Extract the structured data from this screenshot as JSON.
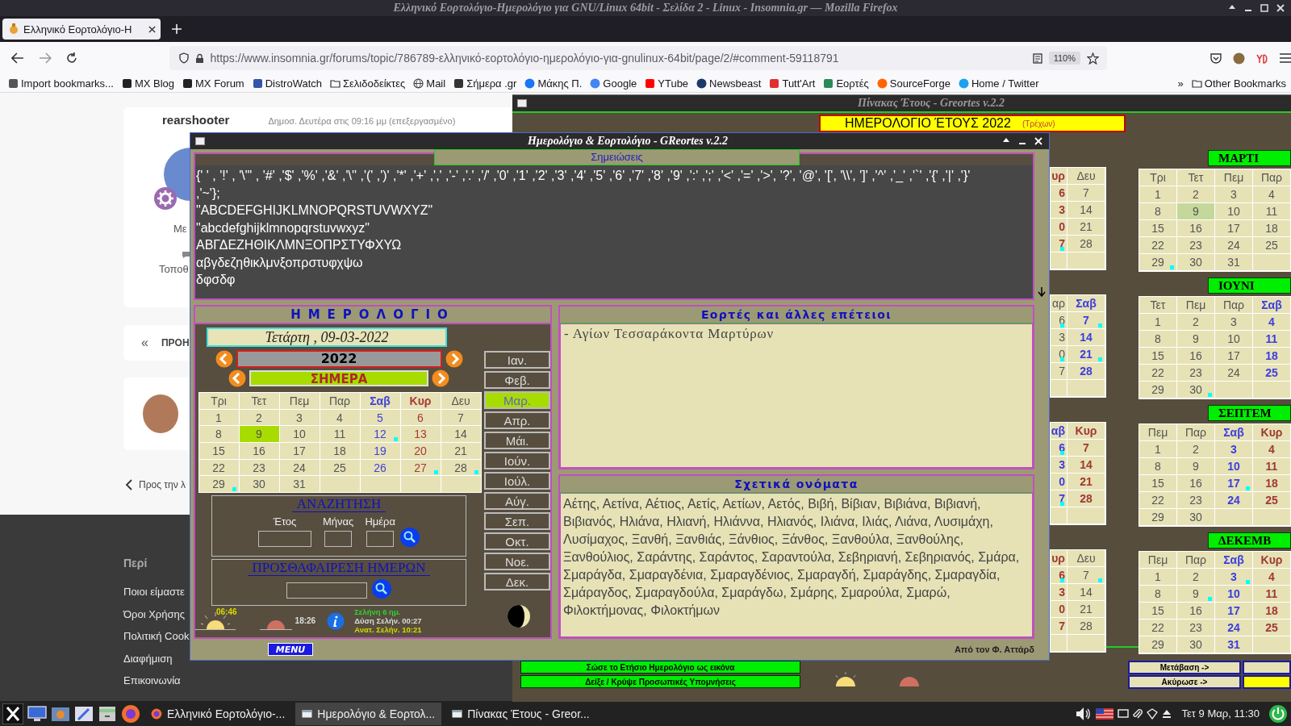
{
  "browser": {
    "title": "Ελληνικό Εορτολόγιο-Ημερολόγιο για GNU/Linux 64bit - Σελίδα 2 - Linux - Insomnia.gr — Mozilla Firefox",
    "tabs": [
      {
        "label": "Ελληνικό Εορτολόγιο-Η",
        "selected": true
      }
    ],
    "url": "https://www.insomnia.gr/forums/topic/786789-ελληνικό-εορτολόγιο-ημερολόγιο-για-gnulinux-64bit/page/2/#comment-59118791",
    "zoom": "110%",
    "bookmarks": [
      {
        "label": "Import bookmarks...",
        "kind": "import"
      },
      {
        "label": "MX Blog",
        "kind": "mx"
      },
      {
        "label": "MX Forum",
        "kind": "mx"
      },
      {
        "label": "DistroWatch",
        "kind": "distro"
      },
      {
        "label": "Σελιδοδείκτες",
        "kind": "folder"
      },
      {
        "label": "Mail",
        "kind": "globe"
      },
      {
        "label": "Σήμερα .gr",
        "kind": "news"
      },
      {
        "label": "Μάκης Π.",
        "kind": "facebook"
      },
      {
        "label": "Google",
        "kind": "google"
      },
      {
        "label": "YTube",
        "kind": "video"
      },
      {
        "label": "Newsbeast",
        "kind": "newsbeast"
      },
      {
        "label": "Tutt'Art",
        "kind": "art"
      },
      {
        "label": "Εορτές",
        "kind": "feasts"
      },
      {
        "label": "SourceForge",
        "kind": "forge"
      },
      {
        "label": "Home / Twitter",
        "kind": "bird"
      }
    ],
    "more": "»",
    "other_bookmarks": "Other Bookmarks"
  },
  "page": {
    "author": "rearshooter",
    "posted": "Δημοσ. Δευτέρα στις 09:16 μμ (επεξεργασμένο)",
    "member": "Με",
    "location": "Τοποθ",
    "prev_arrow": "«",
    "prev": "ΠΡΟΗ",
    "back": "Προς την λ",
    "footer_title": "Περί",
    "footer_links": [
      "Ποιοι είμαστε",
      "Όροι Χρήσης",
      "Πολιτική Cook",
      "Διαφήμιση",
      "Επικοινωνία"
    ]
  },
  "year_window": {
    "title": "Πίνακας Έτους - Greortes v.2.2",
    "heading": "ΗΜΕΡΟΛΟΓΙΟ ΈΤΟΥΣ 2022",
    "heading_note": "(Τρέχων)",
    "left_grids": [
      {
        "columns": [
          {
            "label": "υρ",
            "kind": "sun",
            "cells": [
              {
                "text": "6",
                "dot": false,
                "today": false
              },
              {
                "text": "3",
                "dot": false,
                "today": false
              },
              {
                "text": "0",
                "dot": false,
                "today": false
              },
              {
                "text": "7",
                "dot": true,
                "today": false
              },
              {
                "dot": false,
                "today": false
              }
            ]
          },
          {
            "label": "Δευ",
            "kind": "weekday",
            "cells": [
              {
                "text": "7",
                "dot": false,
                "today": false
              },
              {
                "text": "14",
                "dot": false,
                "today": false
              },
              {
                "text": "21",
                "dot": false,
                "today": false
              },
              {
                "text": "28",
                "dot": false,
                "today": false
              },
              {
                "dot": false,
                "today": false
              }
            ]
          }
        ]
      },
      {
        "columns": [
          {
            "label": "αρ",
            "kind": "weekday",
            "cells": [
              {
                "text": "6",
                "dot": true,
                "today": false
              },
              {
                "text": "3",
                "dot": false,
                "today": false
              },
              {
                "text": "0",
                "dot": true,
                "today": false
              },
              {
                "text": "7",
                "dot": false,
                "today": false
              },
              {
                "dot": false,
                "today": false
              }
            ]
          },
          {
            "label": "Σαβ",
            "kind": "sat",
            "cells": [
              {
                "text": "7",
                "dot": true,
                "today": false
              },
              {
                "text": "14",
                "dot": false,
                "today": false
              },
              {
                "text": "21",
                "dot": true,
                "today": false
              },
              {
                "text": "28",
                "dot": false,
                "today": false
              },
              {
                "dot": false,
                "today": false
              }
            ]
          }
        ]
      },
      {
        "columns": [
          {
            "label": "αβ",
            "kind": "sat",
            "cells": [
              {
                "text": "6",
                "dot": true,
                "today": false
              },
              {
                "text": "3",
                "dot": false,
                "today": false
              },
              {
                "text": "0",
                "dot": false,
                "today": false
              },
              {
                "text": "7",
                "dot": true,
                "today": false
              },
              {
                "dot": false,
                "today": false
              }
            ]
          },
          {
            "label": "Κυρ",
            "kind": "sun",
            "cells": [
              {
                "text": "7",
                "dot": false,
                "today": false
              },
              {
                "text": "14",
                "dot": false,
                "today": false
              },
              {
                "text": "21",
                "dot": false,
                "today": false
              },
              {
                "text": "28",
                "dot": false,
                "today": false
              },
              {
                "dot": false,
                "today": false
              }
            ]
          }
        ]
      },
      {
        "columns": [
          {
            "label": "υρ",
            "kind": "sun",
            "cells": [
              {
                "text": "6",
                "dot": true,
                "today": false
              },
              {
                "text": "3",
                "dot": false,
                "today": false
              },
              {
                "text": "0",
                "dot": false,
                "today": false
              },
              {
                "text": "7",
                "dot": false,
                "today": false
              },
              {
                "dot": false,
                "today": false
              }
            ]
          },
          {
            "label": "Δευ",
            "kind": "weekday",
            "cells": [
              {
                "text": "7",
                "dot": true,
                "today": false
              },
              {
                "text": "14",
                "dot": false,
                "today": false
              },
              {
                "text": "21",
                "dot": false,
                "today": false
              },
              {
                "text": "28",
                "dot": false,
                "today": false
              },
              {
                "dot": false,
                "today": false
              }
            ]
          }
        ]
      }
    ],
    "right_grids": [
      {
        "title": "ΜΑΡΤΙ",
        "columns": [
          {
            "label": "Τρι",
            "kind": "weekday",
            "cells": [
              {
                "text": "1",
                "dot": false,
                "today": false
              },
              {
                "text": "8",
                "dot": false,
                "today": false
              },
              {
                "text": "15",
                "dot": false,
                "today": false
              },
              {
                "text": "22",
                "dot": false,
                "today": false
              },
              {
                "text": "29",
                "dot": true,
                "today": false
              }
            ]
          },
          {
            "label": "Τετ",
            "kind": "weekday",
            "cells": [
              {
                "text": "2",
                "dot": false,
                "today": false
              },
              {
                "text": "9",
                "dot": false,
                "today": true
              },
              {
                "text": "16",
                "dot": false,
                "today": false
              },
              {
                "text": "23",
                "dot": false,
                "today": false
              },
              {
                "text": "30",
                "dot": false,
                "today": false
              }
            ]
          },
          {
            "label": "Πεμ",
            "kind": "weekday",
            "cells": [
              {
                "text": "3",
                "dot": false,
                "today": false
              },
              {
                "text": "10",
                "dot": false,
                "today": false
              },
              {
                "text": "17",
                "dot": false,
                "today": false
              },
              {
                "text": "24",
                "dot": false,
                "today": false
              },
              {
                "text": "31",
                "dot": false,
                "today": false
              }
            ]
          },
          {
            "label": "Παρ",
            "kind": "weekday",
            "cells": [
              {
                "text": "4",
                "dot": false,
                "today": false
              },
              {
                "text": "11",
                "dot": false,
                "today": false
              },
              {
                "text": "18",
                "dot": false,
                "today": false
              },
              {
                "text": "25",
                "dot": false,
                "today": false
              },
              {
                "dot": false,
                "today": false
              }
            ]
          }
        ]
      },
      {
        "title": "ΙΟΥΝΙ",
        "columns": [
          {
            "label": "Τετ",
            "kind": "weekday",
            "cells": [
              {
                "text": "1",
                "dot": false,
                "today": false
              },
              {
                "text": "8",
                "dot": false,
                "today": false
              },
              {
                "text": "15",
                "dot": false,
                "today": false
              },
              {
                "text": "22",
                "dot": false,
                "today": false
              },
              {
                "text": "29",
                "dot": false,
                "today": false
              }
            ]
          },
          {
            "label": "Πεμ",
            "kind": "weekday",
            "cells": [
              {
                "text": "2",
                "dot": false,
                "today": false
              },
              {
                "text": "9",
                "dot": false,
                "today": false
              },
              {
                "text": "16",
                "dot": false,
                "today": false
              },
              {
                "text": "23",
                "dot": false,
                "today": false
              },
              {
                "text": "30",
                "dot": true,
                "today": false
              }
            ]
          },
          {
            "label": "Παρ",
            "kind": "weekday",
            "cells": [
              {
                "text": "3",
                "dot": false,
                "today": false
              },
              {
                "text": "10",
                "dot": false,
                "today": false
              },
              {
                "text": "17",
                "dot": false,
                "today": false
              },
              {
                "text": "24",
                "dot": false,
                "today": false
              },
              {
                "dot": false,
                "today": false
              }
            ]
          },
          {
            "label": "Σαβ",
            "kind": "sat",
            "cells": [
              {
                "text": "4",
                "dot": false,
                "today": false
              },
              {
                "text": "11",
                "dot": false,
                "today": false
              },
              {
                "text": "18",
                "dot": false,
                "today": false
              },
              {
                "text": "25",
                "dot": false,
                "today": false
              },
              {
                "dot": false,
                "today": false
              }
            ]
          }
        ]
      },
      {
        "title": "ΣΕΠΤΕΜ",
        "columns": [
          {
            "label": "Πεμ",
            "kind": "weekday",
            "cells": [
              {
                "text": "1",
                "dot": false,
                "today": false
              },
              {
                "text": "8",
                "dot": false,
                "today": false
              },
              {
                "text": "15",
                "dot": false,
                "today": false
              },
              {
                "text": "22",
                "dot": false,
                "today": false
              },
              {
                "text": "29",
                "dot": false,
                "today": false
              }
            ]
          },
          {
            "label": "Παρ",
            "kind": "weekday",
            "cells": [
              {
                "text": "2",
                "dot": false,
                "today": false
              },
              {
                "text": "9",
                "dot": false,
                "today": false
              },
              {
                "text": "16",
                "dot": false,
                "today": false
              },
              {
                "text": "23",
                "dot": false,
                "today": false
              },
              {
                "text": "30",
                "dot": false,
                "today": false
              }
            ]
          },
          {
            "label": "Σαβ",
            "kind": "sat",
            "cells": [
              {
                "text": "3",
                "dot": false,
                "today": false
              },
              {
                "text": "10",
                "dot": false,
                "today": false
              },
              {
                "text": "17",
                "dot": true,
                "today": false
              },
              {
                "text": "24",
                "dot": false,
                "today": false
              },
              {
                "dot": false,
                "today": false
              }
            ]
          },
          {
            "label": "Κυρ",
            "kind": "sun",
            "cells": [
              {
                "text": "4",
                "dot": false,
                "today": false
              },
              {
                "text": "11",
                "dot": false,
                "today": false
              },
              {
                "text": "18",
                "dot": false,
                "today": false
              },
              {
                "text": "25",
                "dot": false,
                "today": false
              },
              {
                "dot": false,
                "today": false
              }
            ]
          }
        ]
      },
      {
        "title": "ΔΕΚΕΜΒ",
        "columns": [
          {
            "label": "Πεμ",
            "kind": "weekday",
            "cells": [
              {
                "text": "1",
                "dot": false,
                "today": false
              },
              {
                "text": "8",
                "dot": false,
                "today": false
              },
              {
                "text": "15",
                "dot": false,
                "today": false
              },
              {
                "text": "22",
                "dot": false,
                "today": false
              },
              {
                "text": "29",
                "dot": false,
                "today": false
              }
            ]
          },
          {
            "label": "Παρ",
            "kind": "weekday",
            "cells": [
              {
                "text": "2",
                "dot": false,
                "today": false
              },
              {
                "text": "9",
                "dot": true,
                "today": false
              },
              {
                "text": "16",
                "dot": false,
                "today": false
              },
              {
                "text": "23",
                "dot": false,
                "today": false
              },
              {
                "text": "30",
                "dot": false,
                "today": false
              }
            ]
          },
          {
            "label": "Σαβ",
            "kind": "sat",
            "cells": [
              {
                "text": "3",
                "dot": true,
                "today": false
              },
              {
                "text": "10",
                "dot": false,
                "today": false
              },
              {
                "text": "17",
                "dot": false,
                "today": false
              },
              {
                "text": "24",
                "dot": false,
                "today": false
              },
              {
                "text": "31",
                "dot": false,
                "today": false
              }
            ]
          },
          {
            "label": "Κυρ",
            "kind": "sun",
            "cells": [
              {
                "text": "4",
                "dot": false,
                "today": false
              },
              {
                "text": "11",
                "dot": false,
                "today": false
              },
              {
                "text": "18",
                "dot": false,
                "today": false
              },
              {
                "text": "25",
                "dot": false,
                "today": false
              },
              {
                "dot": false,
                "today": false
              }
            ]
          }
        ]
      }
    ],
    "actions": [
      "Σώσε το Ετήσιο Ημερολόγιο ως εικόνα",
      "Δείξε / Κρύψε Προσωπικές Υπομνήσεις"
    ],
    "nav_buttons": [
      "Μετάβαση ->",
      "Ακύρωσε ->"
    ]
  },
  "dialog": {
    "title": "Ημερολόγιο & Εορτολόγιο - GReortes v.2.2",
    "notes_title": "Σημειώσεις",
    "notes": [
      "{' ' , '!' , '\\\"' , '#' ,'$' ,'%' ,'&' ,'\\'' ,'(' ,')' ,'*' ,'+' ,',' ,'-' ,'.' ,'/' ,'0' ,'1' ,'2' ,'3' ,'4' ,'5' ,'6' ,'7' ,'8' ,'9' ,':' ,';' ,'<' ,'=' ,'>', '?', '@', '[', '\\\\', ']' ,'^' ,'_' ,'`' ,'{' ,'|' ,'}'",
      ",'~'};",
      "\"ABCDEFGHIJKLMNOPQRSTUVWXYZ\"",
      "\"abcdefghijklmnopqrstuvwxyz\"",
      "ΑΒΓΔΕΖΗΘΙΚΛΜΝΞΟΠΡΣΤΥΦΧΥΩ",
      "αβγδεζηθικλμνξοπρστυφχψω",
      "δφσδφ"
    ],
    "calendar_title": "ΗΜΕΡΟΛΟΓΙΟ",
    "date": "Τετάρτη , 09-03-2022",
    "year": "2022",
    "today_button": "ΣΗΜΕΡΑ",
    "weekdays": [
      {
        "label": "Τρι",
        "kind": "weekday"
      },
      {
        "label": "Τετ",
        "kind": "weekday"
      },
      {
        "label": "Πεμ",
        "kind": "weekday"
      },
      {
        "label": "Παρ",
        "kind": "weekday"
      },
      {
        "label": "Σαβ",
        "kind": "sat"
      },
      {
        "label": "Κυρ",
        "kind": "sun"
      },
      {
        "label": "Δευ",
        "kind": "weekday"
      }
    ],
    "weeks": [
      [
        {
          "text": "1",
          "dot": false,
          "today": false
        },
        {
          "text": "2",
          "dot": false,
          "today": false
        },
        {
          "text": "3",
          "dot": false,
          "today": false
        },
        {
          "text": "4",
          "dot": false,
          "today": false
        },
        {
          "text": "5",
          "dot": false,
          "today": false
        },
        {
          "text": "6",
          "dot": false,
          "today": false
        },
        {
          "text": "7",
          "dot": false,
          "today": false
        }
      ],
      [
        {
          "text": "8",
          "dot": false,
          "today": false
        },
        {
          "text": "9",
          "dot": false,
          "today": true
        },
        {
          "text": "10",
          "dot": false,
          "today": false
        },
        {
          "text": "11",
          "dot": false,
          "today": false
        },
        {
          "text": "12",
          "dot": true,
          "today": false
        },
        {
          "text": "13",
          "dot": false,
          "today": false
        },
        {
          "text": "14",
          "dot": false,
          "today": false
        }
      ],
      [
        {
          "text": "15",
          "dot": false,
          "today": false
        },
        {
          "text": "16",
          "dot": false,
          "today": false
        },
        {
          "text": "17",
          "dot": false,
          "today": false
        },
        {
          "text": "18",
          "dot": false,
          "today": false
        },
        {
          "text": "19",
          "dot": false,
          "today": false
        },
        {
          "text": "20",
          "dot": false,
          "today": false
        },
        {
          "text": "21",
          "dot": false,
          "today": false
        }
      ],
      [
        {
          "text": "22",
          "dot": false,
          "today": false
        },
        {
          "text": "23",
          "dot": false,
          "today": false
        },
        {
          "text": "24",
          "dot": false,
          "today": false
        },
        {
          "text": "25",
          "dot": false,
          "today": false
        },
        {
          "text": "26",
          "dot": false,
          "today": false
        },
        {
          "text": "27",
          "dot": true,
          "today": false
        },
        {
          "text": "28",
          "dot": true,
          "today": false
        }
      ],
      [
        {
          "text": "29",
          "dot": true,
          "today": false
        },
        {
          "text": "30",
          "dot": false,
          "today": false
        },
        {
          "text": "31",
          "dot": false,
          "today": false
        },
        {
          "dot": false,
          "today": false
        },
        {
          "dot": false,
          "today": false
        },
        {
          "dot": false,
          "today": false
        },
        {
          "dot": false,
          "today": false
        }
      ]
    ],
    "months": [
      {
        "label": "Ιαν.",
        "selected": false
      },
      {
        "label": "Φεβ.",
        "selected": false
      },
      {
        "label": "Μαρ.",
        "selected": true
      },
      {
        "label": "Απρ.",
        "selected": false
      },
      {
        "label": "Μάι.",
        "selected": false
      },
      {
        "label": "Ιούν.",
        "selected": false
      },
      {
        "label": "Ιούλ.",
        "selected": false
      },
      {
        "label": "Αύγ.",
        "selected": false
      },
      {
        "label": "Σεπ.",
        "selected": false
      },
      {
        "label": "Οκτ.",
        "selected": false
      },
      {
        "label": "Νοε.",
        "selected": false
      },
      {
        "label": "Δεκ.",
        "selected": false
      }
    ],
    "search_title": "ΑΝΑΖΗΤΗΣΗ",
    "search_labels": [
      "Έτος",
      "Μήνας",
      "Ημέρα"
    ],
    "offset_title": "ΠΡΟΣΘΑΦΑΙΡΕΣΗ ΗΜΕΡΩΝ",
    "sunrise": "06:46",
    "sunset": "18:26",
    "moon_age": "Σελήνη 6 ημ.",
    "moonset": "Δύση Σελήν. 00:27",
    "moonrise": "Ανατ. Σελήν. 10:21",
    "feasts_title": "Εορτές και άλλες επέτειοι",
    "feasts": [
      "- Αγίων Τεσσαράκοντα Μαρτύρων"
    ],
    "names_title": "Σχετικά ονόματα",
    "names": "Αέτης, Αετίνα, Αέτιος, Αετίς, Αετίων, Αετός, Βιβή, Βίβιαν, Βιβιάνα, Βιβιανή, Βιβιανός, Ηλιάνα, Ηλιανή, Ηλιάννα, Ηλιανός, Ιλιάνα, Ιλιάς, Λιάνα, Λυσιμάχη, Λυσίμαχος, Ξανθή, Ξανθιάς, Ξάνθιος, Ξάνθος, Ξανθούλα, Ξανθούλης, Ξανθούλιος, Σαράντης, Σαράντος, Σαραντούλα, Σεβηριανή, Σεβηριανός, Σμάρα, Σμαράγδα, Σμαραγδένια, Σμαραγδένιος, Σμαραγδή, Σμαράγδης, Σμαραγδία, Σμάραγδος, Σμαραγδούλα, Σμαράγδω, Σμάρης, Σμαρούλα, Σμαρώ, Φιλοκτήμονας, Φιλοκτήμων",
    "menu": "MENU",
    "credit": "Από τον Φ. Αττάρδ"
  },
  "taskbar": {
    "tasks": [
      {
        "label": "Ελληνικό Εορτολόγιο-...",
        "kind": "browser",
        "selected": false
      },
      {
        "label": "Ημερολόγιο & Εορτολ...",
        "kind": "window",
        "selected": true
      },
      {
        "label": "Πίνακας Έτους - Greor...",
        "kind": "window",
        "selected": false
      }
    ],
    "clock": "Τετ 9 Μαρ, 11:30"
  }
}
